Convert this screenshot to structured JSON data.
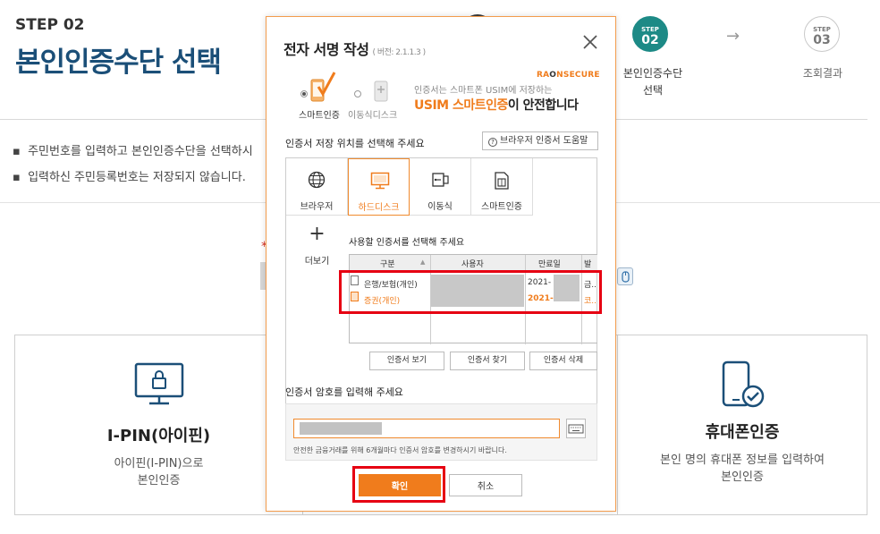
{
  "background": {
    "step_label": "STEP 02",
    "page_title": "본인인증수단 선택",
    "notices": [
      "주민번호를 입력하고 본인인증수단을 선택하시",
      "입력하신 주민등록번호는 저장되지 않습니다."
    ],
    "required_mark": "*",
    "steps": [
      {
        "small": "STEP",
        "num": "02",
        "label_line1": "본인인증수단",
        "label_line2": "선택",
        "active": true
      },
      {
        "small": "STEP",
        "num": "03",
        "label_line1": "조회결과",
        "label_line2": "",
        "active": false
      }
    ],
    "step_arrow": "→",
    "auth_cards": [
      {
        "title": "I-PIN(아이핀)",
        "desc_line1": "아이핀(I-PIN)으로",
        "desc_line2": "본인인증"
      },
      {
        "title": "휴대폰인증",
        "desc_line1": "본인 명의 휴대폰 정보를 입력하여",
        "desc_line2": "본인인증"
      }
    ]
  },
  "modal": {
    "title": "전자 서명 작성",
    "version": "( 버전: 2.1.1.3 )",
    "banner": {
      "option_smart": "스마트인증",
      "option_usb": "이동식디스크",
      "brand_prefix": "RA",
      "brand_mid": "O",
      "brand_suffix": "NSECURE",
      "line1": "인증서는 스마트폰 USIM에 저장하는",
      "line2_highlight": "USIM 스마트인증",
      "line2_rest": "이 안전합니다"
    },
    "storage_label": "인증서 저장 위치를 선택해 주세요",
    "help_button": "브라우저 인증서 도움말",
    "help_icon": "?",
    "tabs": [
      {
        "label": "브라우저",
        "icon": "globe-icon"
      },
      {
        "label": "하드디스크",
        "icon": "monitor-icon",
        "active": true
      },
      {
        "label": "이동식",
        "icon": "usb-icon"
      },
      {
        "label": "스마트인증",
        "icon": "sim-card-icon"
      }
    ],
    "more_tab": {
      "label": "더보기",
      "icon_glyph": "+"
    },
    "cert_select_label": "사용할 인증서를 선택해 주세요",
    "cert_table": {
      "headers": [
        "구분",
        "사용자",
        "만료일",
        "발"
      ],
      "sort_glyph": "▲",
      "rows": [
        {
          "type": "은행/보험(개인)",
          "expiry": "2021-",
          "issuer": "금.."
        },
        {
          "type": "증권(개인)",
          "expiry": "2021-",
          "issuer": "코.."
        }
      ]
    },
    "cert_buttons": [
      "인증서 보기",
      "인증서 찾기",
      "인증서 삭제"
    ],
    "password_label": "인증서 암호를 입력해 주세요",
    "password_hint": "안전한 금융거래를 위해 6개월마다 인증서 암호를 변경하시기 바랍니다.",
    "ok_label": "확인",
    "cancel_label": "취소"
  },
  "colors": {
    "accent_orange": "#f07c1c",
    "title_blue": "#1b4f78",
    "step_active": "#1d8a86",
    "highlight_red": "#e60012"
  }
}
